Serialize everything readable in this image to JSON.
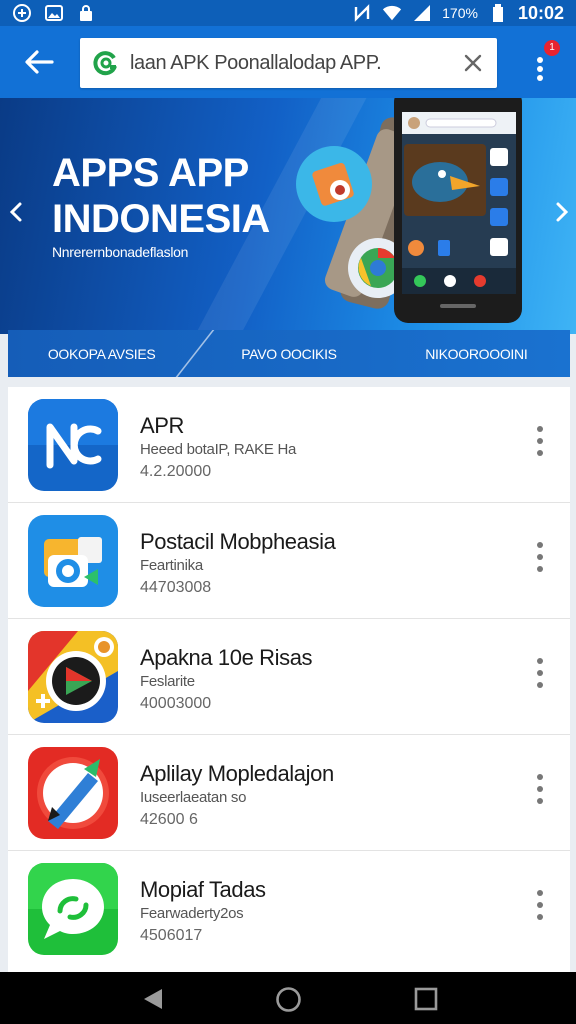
{
  "status_bar": {
    "battery_text": "170%",
    "time": "10:02"
  },
  "app_bar": {
    "search_value": "laan APK Poonallalodap APP.",
    "notification_count": "1"
  },
  "banner": {
    "title_line1": "APPS APP",
    "title_line2": "INDONESIA",
    "subtitle": "Nnrerernbonadeflaslon"
  },
  "category_tabs": [
    "OOKOPA AVSIES",
    "PAVO OOCIKIS",
    "NIKOOROOOINI"
  ],
  "apps": [
    {
      "name": "APR",
      "developer": "Heeed botaIP, RAKE  Ha",
      "count": "4.2.20000"
    },
    {
      "name": "Postacil Mobpheasia",
      "developer": "Feartinika",
      "count": "44703008"
    },
    {
      "name": "Apakna 10e Risas",
      "developer": "Feslarite",
      "count": "40003000"
    },
    {
      "name": "Aplilay Mopledalajon",
      "developer": "Iuseerlaeatan so",
      "count": "42600 6"
    },
    {
      "name": "Mopiaf Tadas",
      "developer": "Fearwaderty2os",
      "count": "4506017"
    }
  ],
  "colors": {
    "app_bar": "#1271d6",
    "status_bar": "#0d5fb8",
    "badge": "#e8232f"
  }
}
